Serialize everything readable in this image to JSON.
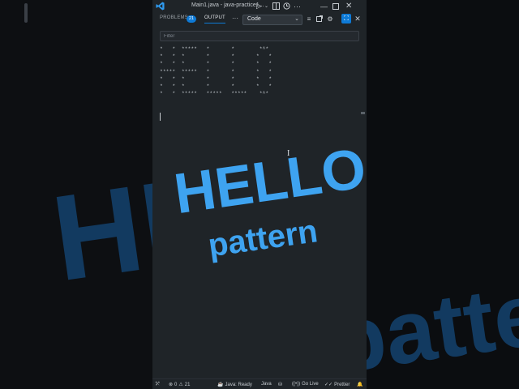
{
  "window": {
    "title": "Main1.java - java-practice1..."
  },
  "panel": {
    "tabs": [
      {
        "label": "PROBLEMS",
        "badge": "21"
      },
      {
        "label": "OUTPUT"
      }
    ],
    "more": "···",
    "channel": "Code",
    "filter_placeholder": "Filter"
  },
  "output": {
    "text": "*   *  *****   *       *        *^*\n*   *  *       *       *       *   *\n*   *  *       *       *       *   *\n*****  *****   *       *       *   *\n*   *  *       *       *       *   *\n*   *  *       *       *       *   *\n*   *  *****   *****   *****    *^*"
  },
  "overlay": {
    "hello": "HELLO",
    "pattern": "pattern"
  },
  "statusbar": {
    "errors": "0",
    "warnings": "21",
    "java_status": "Java: Ready",
    "language": "Java",
    "go_live": "Go Live",
    "prettier": "Prettier"
  },
  "colors": {
    "accent": "#0e7ad6",
    "overlay_text": "#3ea3f0",
    "background_text": "#123a60",
    "panel_bg": "#1f2428"
  }
}
